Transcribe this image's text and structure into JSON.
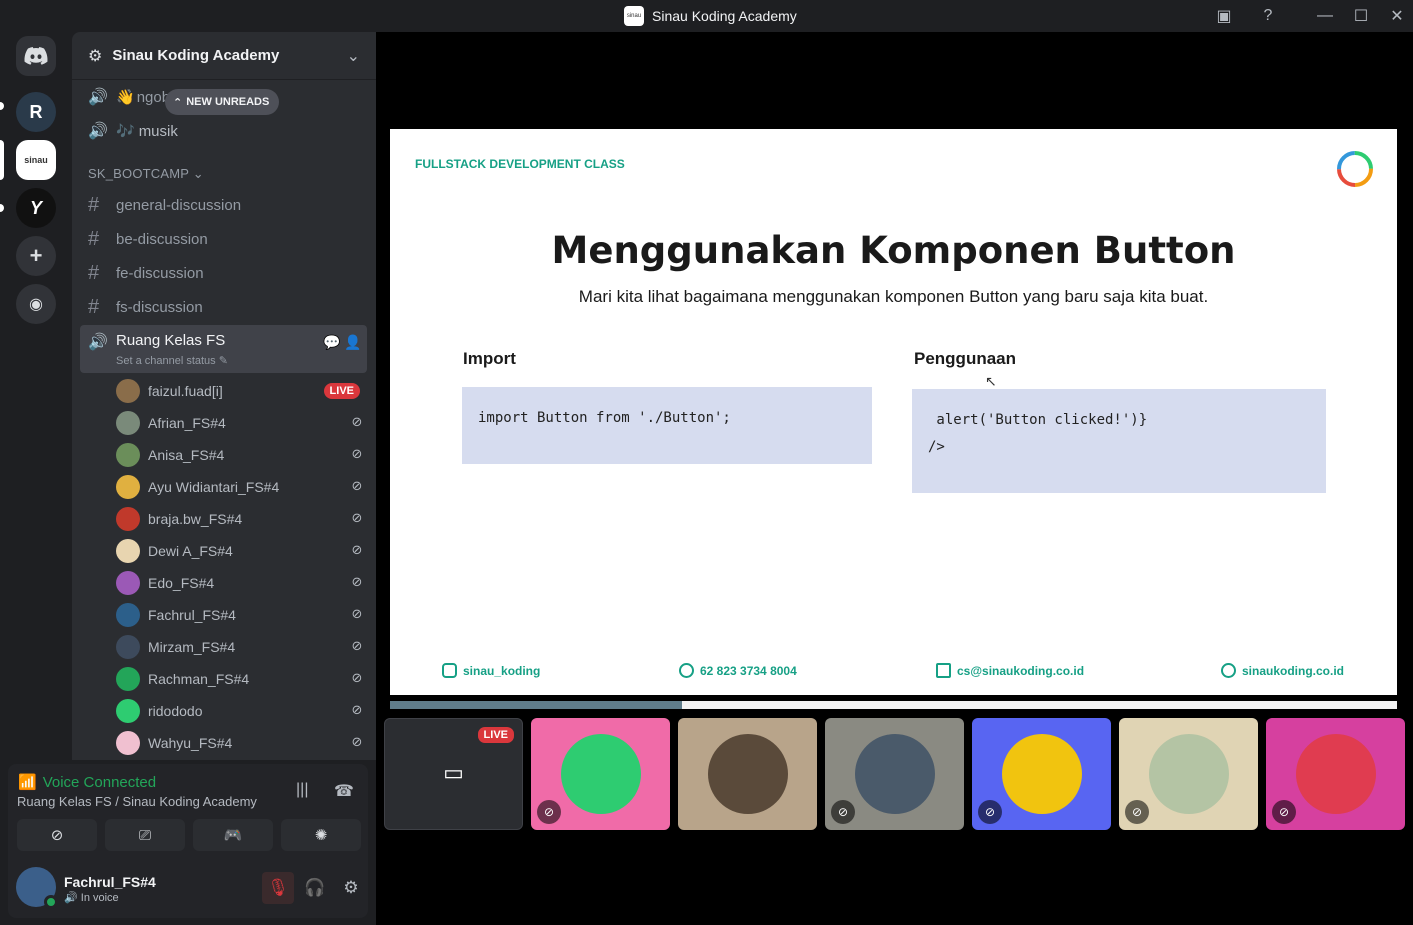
{
  "window": {
    "title": "Sinau Koding Academy"
  },
  "rail": {
    "servers": [
      "discord-home",
      "r-server",
      "sinau-server",
      "yo-server",
      "add-server",
      "explore"
    ]
  },
  "server": {
    "name": "Sinau Koding Academy"
  },
  "channels_top": [
    {
      "name": "ngobrol",
      "icon": "👋"
    },
    {
      "name": "musik",
      "icon": "🎶"
    }
  ],
  "new_unreads": "NEW UNREADS",
  "category": "SK_BOOTCAMP",
  "text_channels": [
    "general-discussion",
    "be-discussion",
    "fe-discussion",
    "fs-discussion"
  ],
  "voice_channel": {
    "name": "Ruang Kelas FS",
    "status_placeholder": "Set a channel status",
    "members": [
      {
        "name": "faizul.fuad[i]",
        "live": "LIVE",
        "color": "#8a6d4a"
      },
      {
        "name": "Afrian_FS#4",
        "color": "#7a8a7a"
      },
      {
        "name": "Anisa_FS#4",
        "color": "#6b8e5a"
      },
      {
        "name": "Ayu Widiantari_FS#4",
        "color": "#e0b040"
      },
      {
        "name": "braja.bw_FS#4",
        "color": "#c0392b"
      },
      {
        "name": "Dewi A_FS#4",
        "color": "#e8d5b0"
      },
      {
        "name": "Edo_FS#4",
        "color": "#9b59b6"
      },
      {
        "name": "Fachrul_FS#4",
        "color": "#2c5f8a"
      },
      {
        "name": "Mirzam_FS#4",
        "color": "#3d4a5c"
      },
      {
        "name": "Rachman_FS#4",
        "color": "#23a559"
      },
      {
        "name": "ridododo",
        "color": "#2ecc71"
      },
      {
        "name": "Wahyu_FS#4",
        "color": "#f0c0d0"
      }
    ]
  },
  "voice_panel": {
    "title": "Voice Connected",
    "subtitle": "Ruang Kelas FS / Sinau Koding Academy"
  },
  "user": {
    "name": "Fachrul_FS#4",
    "status": "In voice"
  },
  "slide": {
    "class_label": "FULLSTACK DEVELOPMENT CLASS",
    "title": "Menggunakan Komponen Button",
    "subtitle": "Mari kita lihat bagaimana menggunakan komponen Button yang baru saja kita buat.",
    "left_heading": "Import",
    "left_code": "import Button from './Button';",
    "right_heading": "Penggunaan",
    "right_code": " alert('Button clicked!')}\n/>",
    "footer": {
      "instagram": "sinau_koding",
      "whatsapp": "62 823 3734 8004",
      "email": "cs@sinaukoding.co.id",
      "website": "sinaukoding.co.id"
    }
  },
  "stream_progress": 0.29,
  "tiles": [
    {
      "kind": "stream",
      "live": "LIVE",
      "bg": "#2b2d31"
    },
    {
      "kind": "avatar",
      "bg": "#f06ba8",
      "face": "#2ecc71"
    },
    {
      "kind": "photo",
      "bg": "#b8a48a",
      "face": "#5a4a3a"
    },
    {
      "kind": "photo",
      "bg": "#8a8a82",
      "face": "#4a5a6a"
    },
    {
      "kind": "avatar",
      "bg": "#5865f2",
      "face": "#f1c40f"
    },
    {
      "kind": "photo",
      "bg": "#e0d4b4",
      "face": "#b4c4a4"
    },
    {
      "kind": "avatar",
      "bg": "#d6409f",
      "face": "#e03c50"
    }
  ]
}
